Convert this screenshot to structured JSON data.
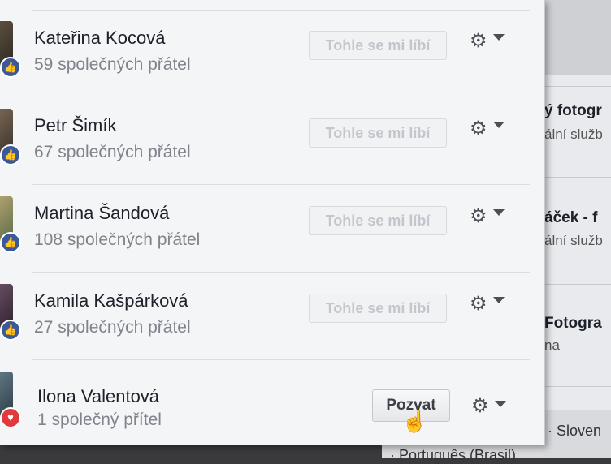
{
  "friends": [
    {
      "name": "Kateřina Kocová",
      "mutual": "59 společných přátel",
      "action": "Tohle se mi líbí",
      "reaction": "like"
    },
    {
      "name": "Petr Šimík",
      "mutual": "67 společných přátel",
      "action": "Tohle se mi líbí",
      "reaction": "like"
    },
    {
      "name": "Martina Šandová",
      "mutual": "108 společných přátel",
      "action": "Tohle se mi líbí",
      "reaction": "like"
    },
    {
      "name": "Kamila Kašpárková",
      "mutual": "27 společných přátel",
      "action": "Tohle se mi líbí",
      "reaction": "like"
    },
    {
      "name": "Ilona Valentová",
      "mutual": "1 společný přítel",
      "action": "Pozvat",
      "reaction": "love"
    }
  ],
  "icons": {
    "like": "thumbs-up-icon",
    "love": "heart-icon",
    "settings": "gear-icon",
    "menu": "caret-down-icon"
  },
  "background": {
    "titles": [
      "ý fotogr",
      "áček - f",
      "Fotogra"
    ],
    "subs": [
      "ální služb",
      "ální služb",
      "na"
    ],
    "languages": [
      "· Sloven",
      "· Português (Brasil)"
    ]
  },
  "colors": {
    "accent": "#3b5998",
    "love": "#e0393e",
    "muted": "#7f838a"
  }
}
